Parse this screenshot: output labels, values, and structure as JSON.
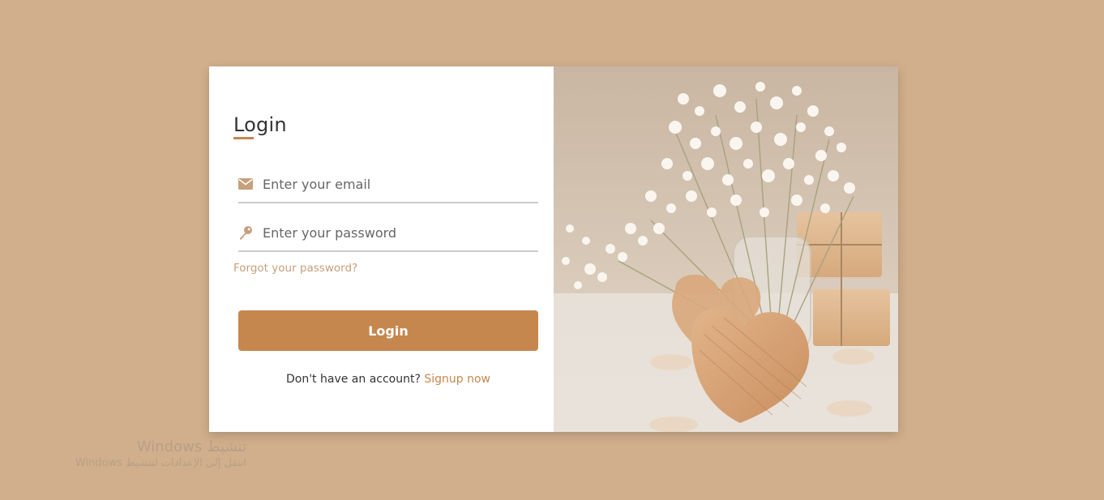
{
  "login": {
    "title": "Login",
    "email_placeholder": "Enter your email",
    "password_placeholder": "Enter your password",
    "forgot_label": "Forgot your password?",
    "button_label": "Login",
    "signup_prompt": "Don't have an account?",
    "signup_link": "Signup now",
    "icons": {
      "email": "envelope-icon",
      "password": "key-icon"
    }
  },
  "watermark": {
    "line1": "تنشيط Windows",
    "line2": "انتقل إلى الإعدادات لتنشيط Windows"
  },
  "colors": {
    "page_background": "#d1af8c",
    "accent": "#c6874e",
    "link_muted": "#c6a07c"
  }
}
